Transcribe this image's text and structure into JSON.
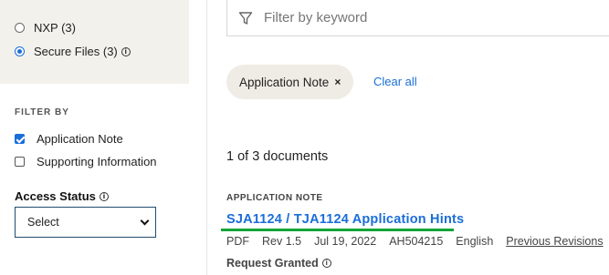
{
  "sidebar": {
    "sources": [
      {
        "label": "NXP (3)",
        "checked": false
      },
      {
        "label": "Secure Files (3)",
        "checked": true
      }
    ],
    "filter_by_heading": "FILTER BY",
    "doc_types": [
      {
        "label": "Application Note",
        "checked": true
      },
      {
        "label": "Supporting Information",
        "checked": false
      }
    ],
    "access_status_label": "Access Status",
    "access_status_value": "Select"
  },
  "search": {
    "placeholder": "Filter by keyword",
    "icon": "filter-funnel-icon"
  },
  "active_filters": {
    "chip_label": "Application Note",
    "chip_remove": "×",
    "clear_all": "Clear all"
  },
  "results": {
    "count_text": "1 of 3 documents",
    "document": {
      "type": "APPLICATION NOTE",
      "title": "SJA1124 / TJA1124 Application Hints",
      "format": "PDF",
      "revision": "Rev 1.5",
      "date": "Jul 19, 2022",
      "doc_id": "AH504215",
      "language": "English",
      "previous_revisions": "Previous Revisions",
      "access": "Request Granted"
    }
  },
  "colors": {
    "accent_blue": "#1a6ed8",
    "panel_beige": "#f3f1ec",
    "chip_bg": "#efece5",
    "highlight_green": "#13a538"
  }
}
